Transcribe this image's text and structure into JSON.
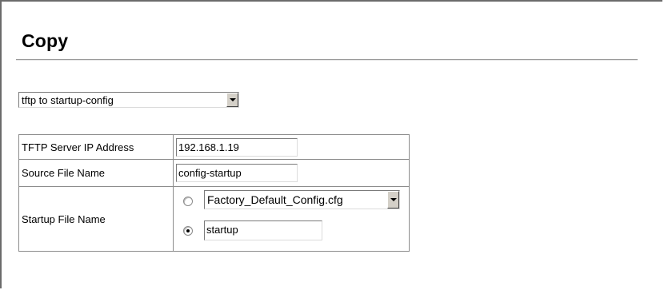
{
  "page": {
    "title": "Copy"
  },
  "operation": {
    "selected": "tftp to startup-config"
  },
  "form": {
    "rows": [
      {
        "label": "TFTP Server IP Address",
        "value": "192.168.1.19"
      },
      {
        "label": "Source File Name",
        "value": "config-startup"
      },
      {
        "label": "Startup File Name"
      }
    ],
    "startup": {
      "options": [
        {
          "kind": "select",
          "value": "Factory_Default_Config.cfg",
          "checked": false
        },
        {
          "kind": "input",
          "value": "startup",
          "checked": true
        }
      ]
    }
  }
}
